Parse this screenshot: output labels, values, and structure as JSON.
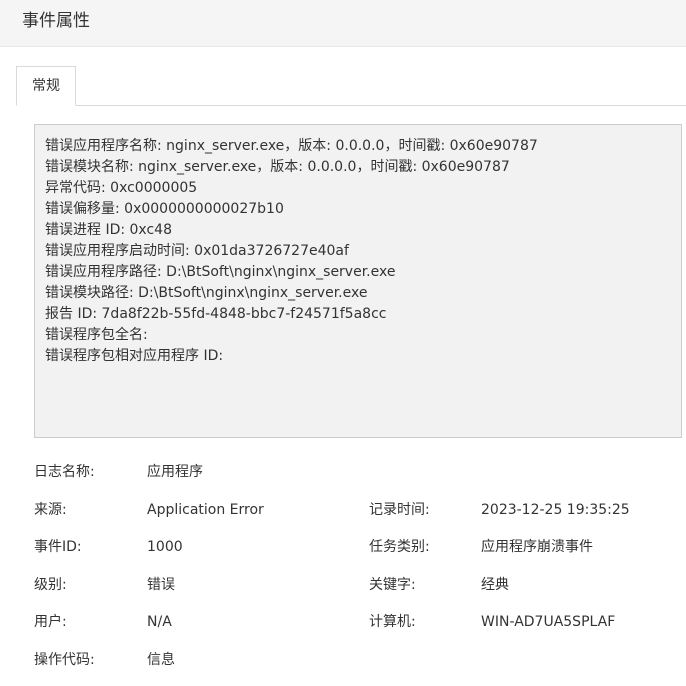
{
  "window": {
    "title": "事件属性"
  },
  "tabs": [
    {
      "label": "常规"
    }
  ],
  "description_lines": [
    "错误应用程序名称: nginx_server.exe，版本: 0.0.0.0，时间戳: 0x60e90787",
    "错误模块名称: nginx_server.exe，版本: 0.0.0.0，时间戳: 0x60e90787",
    "异常代码: 0xc0000005",
    "错误偏移量: 0x0000000000027b10",
    "错误进程 ID: 0xc48",
    "错误应用程序启动时间: 0x01da3726727e40af",
    "错误应用程序路径: D:\\BtSoft\\nginx\\nginx_server.exe",
    "错误模块路径: D:\\BtSoft\\nginx\\nginx_server.exe",
    "报告 ID: 7da8f22b-55fd-4848-bbc7-f24571f5a8cc",
    "错误程序包全名:",
    "错误程序包相对应用程序 ID:"
  ],
  "properties": {
    "log_name": {
      "label": "日志名称:",
      "value": "应用程序"
    },
    "source": {
      "label": "来源:",
      "value": "Application Error"
    },
    "logged": {
      "label": "记录时间:",
      "value": "2023-12-25 19:35:25"
    },
    "event_id": {
      "label": "事件ID:",
      "value": "1000"
    },
    "task_category": {
      "label": "任务类别:",
      "value": "应用程序崩溃事件"
    },
    "level": {
      "label": "级别:",
      "value": "错误"
    },
    "keywords": {
      "label": "关键字:",
      "value": "经典"
    },
    "user": {
      "label": "用户:",
      "value": "N/A"
    },
    "computer": {
      "label": "计算机:",
      "value": "WIN-AD7UA5SPLAF"
    },
    "opcode": {
      "label": "操作代码:",
      "value": "信息"
    }
  }
}
